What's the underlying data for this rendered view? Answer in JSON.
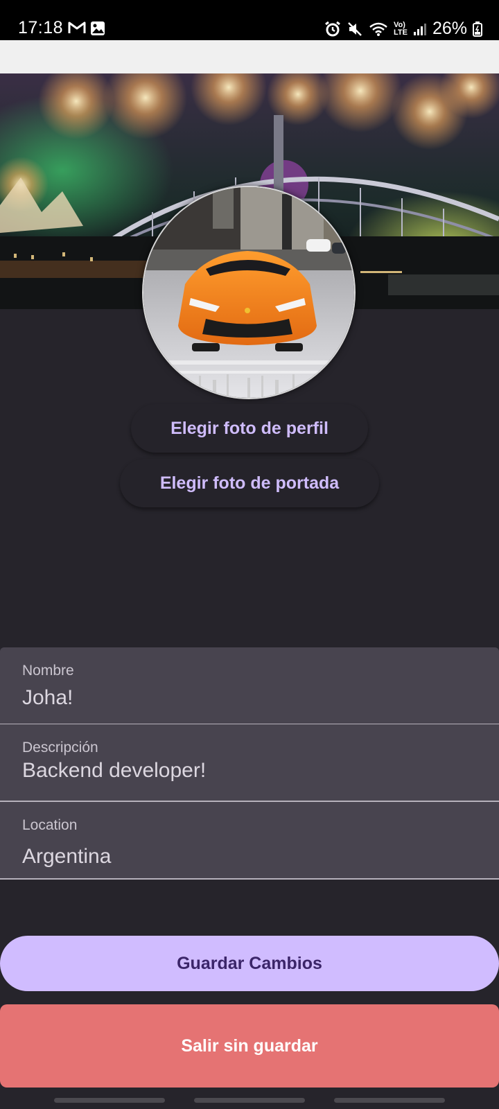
{
  "status_bar": {
    "time": "17:18",
    "left_icons": [
      "gmail-icon",
      "gallery-icon"
    ],
    "right_icons": [
      "alarm-icon",
      "mute-icon",
      "wifi-icon",
      "volte-icon",
      "signal-icon",
      "battery-icon"
    ],
    "volte_label_top": "Vo)",
    "volte_label_bottom": "LTE",
    "battery": "26%"
  },
  "profile": {
    "choose_profile_photo": "Elegir foto de perfil",
    "choose_cover_photo": "Elegir foto de portada"
  },
  "form": {
    "name": {
      "label": "Nombre",
      "value": "Joha!"
    },
    "description": {
      "label": "Descripción",
      "value": "Backend developer!"
    },
    "location": {
      "label": "Location",
      "value": "Argentina"
    }
  },
  "actions": {
    "save": "Guardar Cambios",
    "exit": "Salir sin guardar"
  },
  "colors": {
    "background": "#26242b",
    "accent": "#d0bcff",
    "field": "#48444f",
    "danger": "#e57373"
  }
}
